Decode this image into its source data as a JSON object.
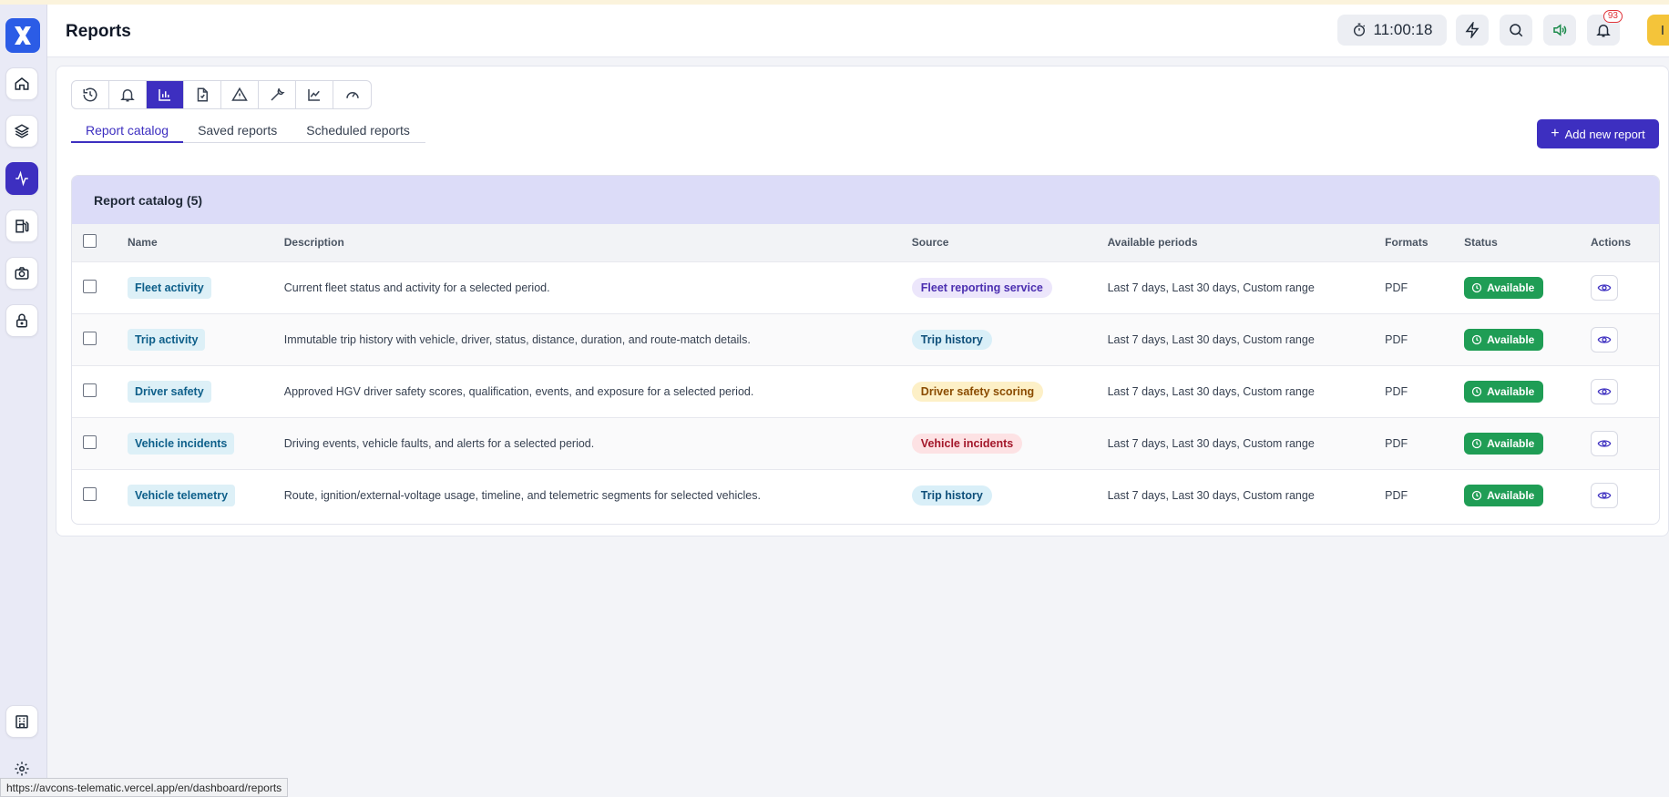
{
  "header": {
    "title": "Reports",
    "clock": "11:00:18",
    "notifications_count": "93",
    "user_initial": "I"
  },
  "sidebar": {
    "items": [
      {
        "icon": "home-icon",
        "active": false
      },
      {
        "icon": "layers-icon",
        "active": false
      },
      {
        "icon": "activity-icon",
        "active": true
      },
      {
        "icon": "fuel-icon",
        "active": false
      },
      {
        "icon": "camera-icon",
        "active": false
      },
      {
        "icon": "lock-icon",
        "active": false
      }
    ],
    "bottom_items": [
      {
        "icon": "building-icon"
      },
      {
        "icon": "gear-icon"
      }
    ]
  },
  "toolbar": {
    "icons": [
      "history-icon",
      "bell-icon",
      "bar-chart-icon",
      "file-icon",
      "warning-icon",
      "wrench-icon",
      "line-chart-icon",
      "gauge-icon"
    ],
    "active_index": 2
  },
  "tabs": [
    "Report catalog",
    "Saved reports",
    "Scheduled reports"
  ],
  "active_tab": 0,
  "add_button_label": "Add new report",
  "catalog": {
    "title": "Report catalog (5)",
    "columns": [
      "Name",
      "Description",
      "Source",
      "Available periods",
      "Formats",
      "Status",
      "Actions"
    ],
    "rows": [
      {
        "name": "Fleet activity",
        "description": "Current fleet status and activity for a selected period.",
        "source": "Fleet reporting service",
        "periods": "Last 7 days, Last 30 days, Custom range",
        "format": "PDF",
        "status": "Available"
      },
      {
        "name": "Trip activity",
        "description": "Immutable trip history with vehicle, driver, status, distance, duration, and route-match details.",
        "source": "Trip history",
        "periods": "Last 7 days, Last 30 days, Custom range",
        "format": "PDF",
        "status": "Available"
      },
      {
        "name": "Driver safety",
        "description": "Approved HGV driver safety scores, qualification, events, and exposure for a selected period.",
        "source": "Driver safety scoring",
        "periods": "Last 7 days, Last 30 days, Custom range",
        "format": "PDF",
        "status": "Available"
      },
      {
        "name": "Vehicle incidents",
        "description": "Driving events, vehicle faults, and alerts for a selected period.",
        "source": "Vehicle incidents",
        "periods": "Last 7 days, Last 30 days, Custom range",
        "format": "PDF",
        "status": "Available"
      },
      {
        "name": "Vehicle telemetry",
        "description": "Route, ignition/external-voltage usage, timeline, and telemetric segments for selected vehicles.",
        "source": "Trip history",
        "periods": "Last 7 days, Last 30 days, Custom range",
        "format": "PDF",
        "status": "Available"
      }
    ]
  },
  "source_colors": {
    "Fleet reporting service": {
      "bg": "#ece6fb",
      "fg": "#4b2fb0"
    },
    "Trip history": {
      "bg": "#d9eff8",
      "fg": "#0e4f7a"
    },
    "Driver safety scoring": {
      "bg": "#fdf0c7",
      "fg": "#8a4b00"
    },
    "Vehicle incidents": {
      "bg": "#fde2e4",
      "fg": "#a3172a"
    }
  },
  "status_url": "https://avcons-telematic.vercel.app/en/dashboard/reports"
}
